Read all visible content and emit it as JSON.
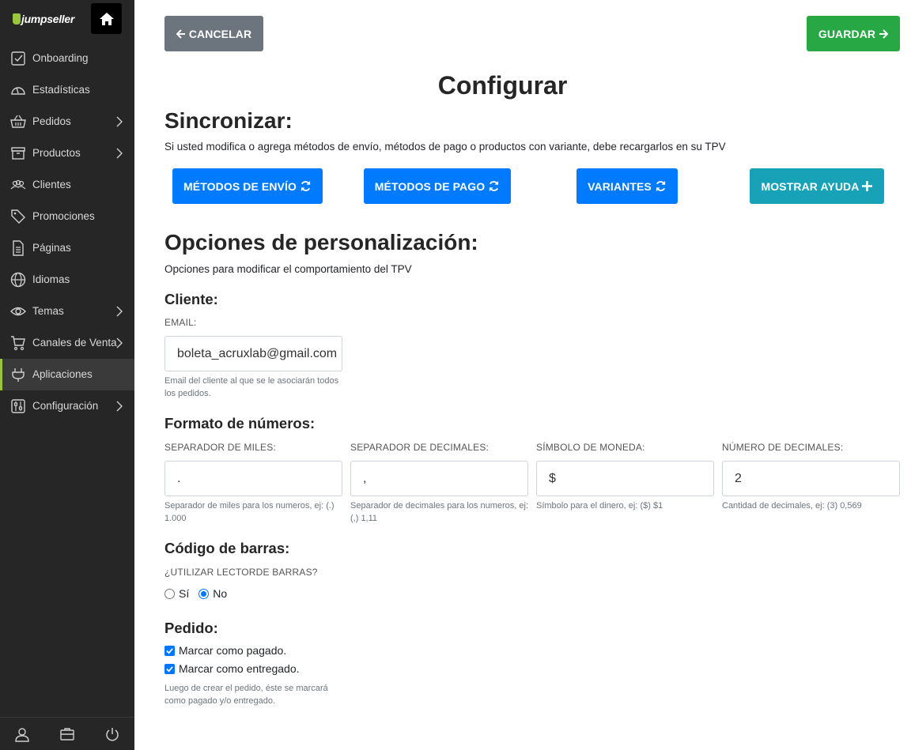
{
  "sidebar": {
    "logo_text": "jumpseller",
    "items": [
      {
        "label": "Onboarding",
        "icon": "checkbox-icon",
        "has_chevron": false
      },
      {
        "label": "Estadísticas",
        "icon": "gauge-icon",
        "has_chevron": false
      },
      {
        "label": "Pedidos",
        "icon": "basket-icon",
        "has_chevron": true
      },
      {
        "label": "Productos",
        "icon": "box-icon",
        "has_chevron": true
      },
      {
        "label": "Clientes",
        "icon": "users-icon",
        "has_chevron": false
      },
      {
        "label": "Promociones",
        "icon": "tags-icon",
        "has_chevron": false
      },
      {
        "label": "Páginas",
        "icon": "document-icon",
        "has_chevron": false
      },
      {
        "label": "Idiomas",
        "icon": "globe-icon",
        "has_chevron": false
      },
      {
        "label": "Temas",
        "icon": "eye-icon",
        "has_chevron": true
      },
      {
        "label": "Canales de Venta",
        "icon": "cart-icon",
        "has_chevron": true
      },
      {
        "label": "Aplicaciones",
        "icon": "plug-icon",
        "has_chevron": false,
        "active": true
      },
      {
        "label": "Configuración",
        "icon": "sliders-icon",
        "has_chevron": true
      }
    ],
    "bottom_icons": [
      "user-icon",
      "briefcase-icon",
      "power-icon"
    ],
    "accent": "#9bc53d"
  },
  "toolbar": {
    "cancel_label": "CANCELAR",
    "save_label": "GUARDAR"
  },
  "page_title": "Configurar",
  "sync": {
    "heading": "Sincronizar:",
    "description": "Si usted modifica o agrega métodos de envío, métodos de pago o productos con variante, debe recargarlos en su TPV",
    "shipping_button": "MÉTODOS DE ENVÍO",
    "payment_button": "MÉTODOS DE PAGO",
    "variants_button": "VARIANTES",
    "help_button": "MOSTRAR AYUDA"
  },
  "options": {
    "heading": "Opciones de personalización:",
    "description": "Opciones para modificar el comportamiento del TPV"
  },
  "client": {
    "heading": "Cliente:",
    "email_label": "EMAIL:",
    "email_value": "boleta_acruxlab@gmail.com",
    "email_help": "Email del cliente al que se le asociarán todos los pedidos."
  },
  "numbers": {
    "heading": "Formato de números:",
    "fields": [
      {
        "label": "SEPARADOR DE MILES:",
        "value": ".",
        "help": "Separador de miles para los numeros, ej: (.) 1.000"
      },
      {
        "label": "SEPARADOR DE DECIMALES:",
        "value": ",",
        "help": "Separador de decimales para los numeros, ej: (,) 1,11"
      },
      {
        "label": "SÍMBOLO DE MONEDA:",
        "value": "$",
        "help": "Símbolo para el dinero, ej: ($) $1"
      },
      {
        "label": "NÚMERO DE DECIMALES:",
        "value": "2",
        "help": "Cantidad de decimales, ej: (3) 0,569"
      }
    ]
  },
  "barcode": {
    "heading": "Código de barras:",
    "question": "¿UTILIZAR LECTORDE BARRAS?",
    "option_yes": "Sí",
    "option_no": "No",
    "selected": "No"
  },
  "order": {
    "heading": "Pedido:",
    "mark_paid": "Marcar como pagado.",
    "mark_delivered": "Marcar como entregado.",
    "help": "Luego de crear el pedido, éste se marcará como pagado y/o entregado."
  },
  "colors": {
    "cancel": "#6c757d",
    "save": "#28a745",
    "primary": "#007bff",
    "info": "#17a2b8"
  }
}
